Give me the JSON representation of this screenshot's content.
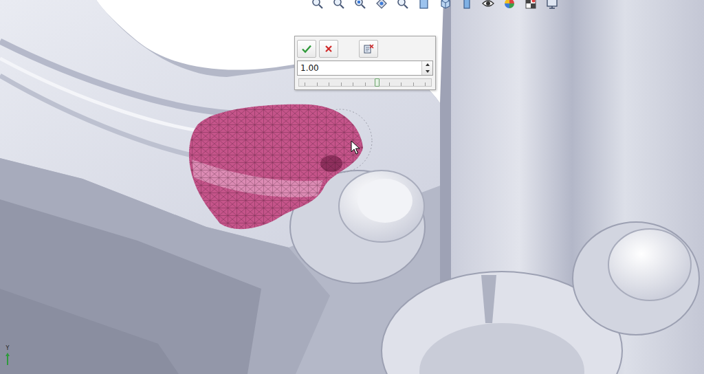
{
  "dialog": {
    "value": "1.00",
    "slider": {
      "level": 0.59
    }
  },
  "axis": {
    "label": "Y"
  }
}
